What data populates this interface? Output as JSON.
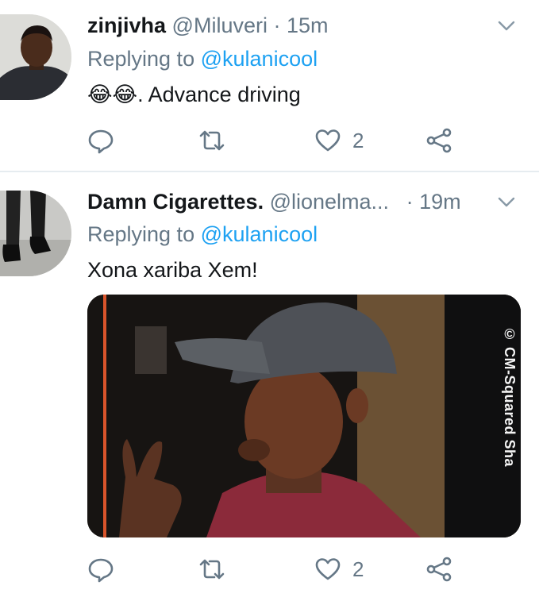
{
  "tweets": [
    {
      "display_name": "zinjivha",
      "handle": "@Miluveri",
      "separator": "·",
      "time": "15m",
      "replying_prefix": "Replying to",
      "replying_to": "@kulanicool",
      "emoji": "😂😂",
      "text": ". Advance driving",
      "likes": "2",
      "icons": [
        "chevron-down-icon",
        "reply-icon",
        "retweet-icon",
        "heart-icon",
        "share-icon"
      ]
    },
    {
      "display_name": "Damn Cigarettes.",
      "handle": "@lionelma...",
      "separator": "·",
      "time": "19m",
      "replying_prefix": "Replying to",
      "replying_to": "@kulanicool",
      "text": "Xona xariba Xem!",
      "media_watermark": "© CM-Squared Sha",
      "likes": "2",
      "icons": [
        "chevron-down-icon",
        "reply-icon",
        "retweet-icon",
        "heart-icon",
        "share-icon"
      ]
    }
  ],
  "colors": {
    "link": "#1da1f2",
    "muted": "#657786",
    "text": "#14171a",
    "divider": "#e6ecf0"
  }
}
